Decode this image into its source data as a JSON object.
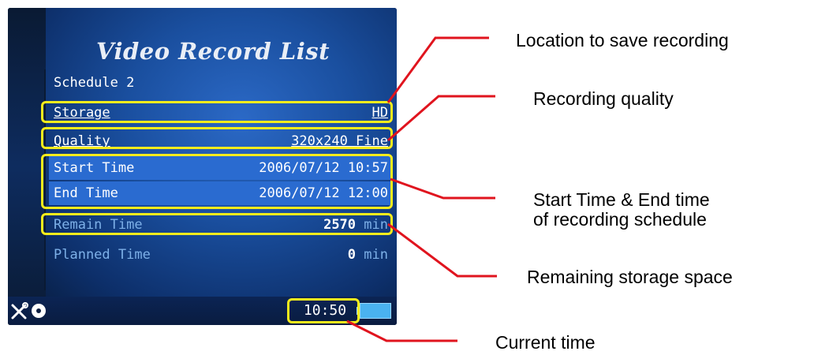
{
  "screen": {
    "title": "Video Record List",
    "schedule_label": "Schedule 2",
    "rows": [
      {
        "label": "Storage",
        "value": "HD"
      },
      {
        "label": "Quality",
        "value": "320x240 Fine"
      },
      {
        "label": "Start Time",
        "value": "2006/07/12 10:57"
      },
      {
        "label": "End Time",
        "value": "2006/07/12 12:00"
      },
      {
        "label": "Remain Time",
        "value_num": "2570",
        "value_unit": "min"
      },
      {
        "label": "Planned Time",
        "value_num": "0",
        "value_unit": "min"
      }
    ],
    "status_bar": {
      "clock": "10:50",
      "icons": [
        "tools-icon",
        "disc-icon",
        "battery-icon"
      ]
    }
  },
  "annotations": {
    "storage": "Location to save recording",
    "quality": "Recording quality",
    "time_line1": "Start Time & End time",
    "time_line2": "of recording schedule",
    "remain": "Remaining storage space",
    "clock": "Current time"
  },
  "colors": {
    "highlight_box": "#f5ec1c",
    "callout_line": "#e0141e",
    "row_highlight": "#2a6bd0",
    "dim_text": "#7db0e8"
  }
}
